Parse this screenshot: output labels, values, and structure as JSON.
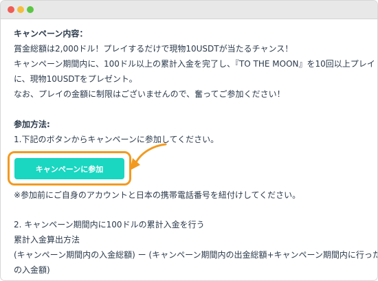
{
  "colors": {
    "dot_close": "#ee5d55",
    "dot_minimize": "#f4bd3f",
    "dot_zoom": "#5cc644",
    "cta_background": "#19d7c1",
    "highlight": "#f29a1f"
  },
  "window": {
    "controls": [
      "close-dot",
      "minimize-dot",
      "zoom-dot"
    ]
  },
  "content": {
    "heading_details": "キャンペーン内容：",
    "details_line1": "賞金総額は2,000ドル！プレイするだけで現物10USDTが当たるチャンス！",
    "details_line2": "キャンペーン期間内に、100ドル以上の累計入金を完了し、『TO THE MOON』を10回以上プレイ",
    "details_line3": "に、現物10USDTをプレゼント。",
    "details_line4": "なお、プレイの金額に制限はございませんので、奮ってご参加ください！",
    "heading_method": "参加方法:",
    "step1": "1.下記のボタンからキャンペーンに参加してください。",
    "cta_label": "キャンペーンに参加",
    "note": "※参加前にご自身のアカウントと日本の携帯電話番号を紐付けしてください。",
    "step2": "2. キャンペーン期間内に100ドルの累計入金を行う",
    "calc_heading": "累計入金算出方法",
    "calc_line1": "(キャンペーン期間内の入金総額) ー (キャンペーン期間内の出金総額+キャンペーン期間内に行った",
    "calc_line2": "の入金額)"
  }
}
